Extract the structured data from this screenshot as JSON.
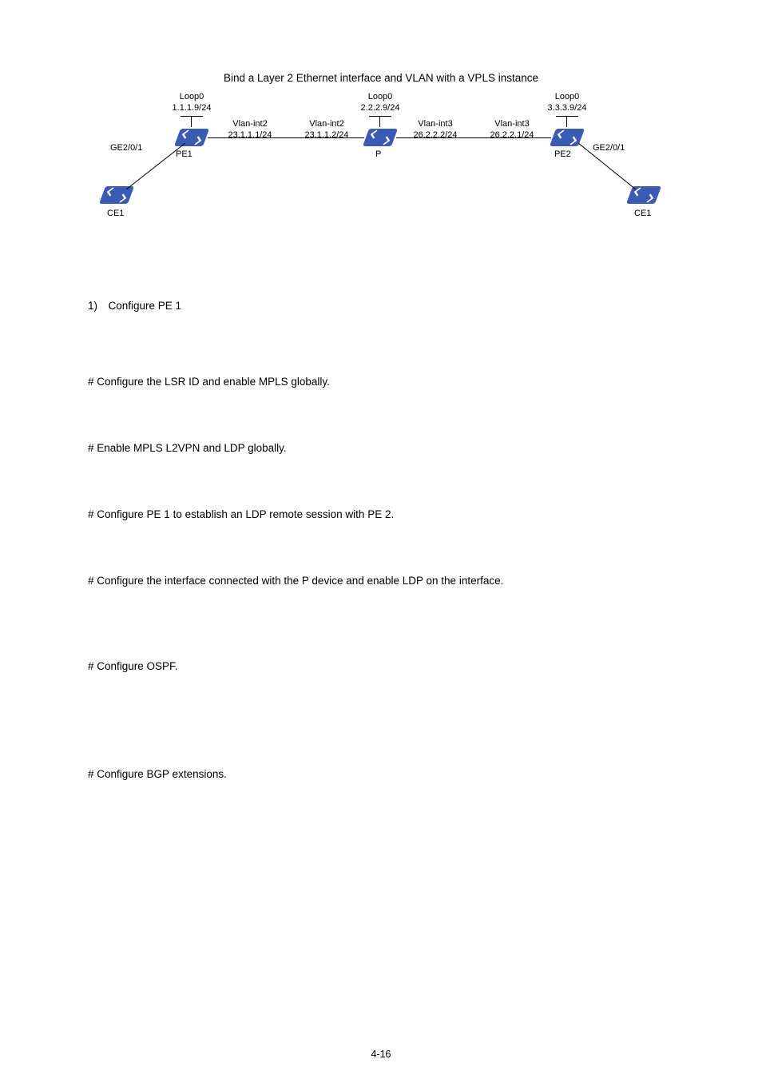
{
  "figure": {
    "title": "Bind a Layer 2 Ethernet interface and VLAN with a VPLS instance",
    "nodes": {
      "pe1": "PE1",
      "p": "P",
      "pe2": "PE2",
      "ce1_left": "CE1",
      "ce1_right": "CE1"
    },
    "labels": {
      "loop_pe1": "Loop0\n1.1.1.9/24",
      "loop_p": "Loop0\n2.2.2.9/24",
      "loop_pe2": "Loop0\n3.3.3.9/24",
      "vlan_pe1_right": "Vlan-int2\n23.1.1.1/24",
      "vlan_p_left": "Vlan-int2\n23.1.1.2/24",
      "vlan_p_right": "Vlan-int3\n26.2.2.2/24",
      "vlan_pe2_left": "Vlan-int3\n26.2.2.1/24",
      "ge_left": "GE2/0/1",
      "ge_right": "GE2/0/1"
    }
  },
  "heading1": "1) Configure PE 1",
  "step1": "# Configure the LSR ID and enable MPLS globally.",
  "step2": "# Enable MPLS L2VPN and LDP globally.",
  "step3": "# Configure PE 1 to establish an LDP remote session with PE 2.",
  "step4": "# Configure the interface connected with the P device and enable LDP on the interface.",
  "step5": "# Configure OSPF.",
  "step6": "# Configure BGP extensions.",
  "pagenum": "4-16"
}
